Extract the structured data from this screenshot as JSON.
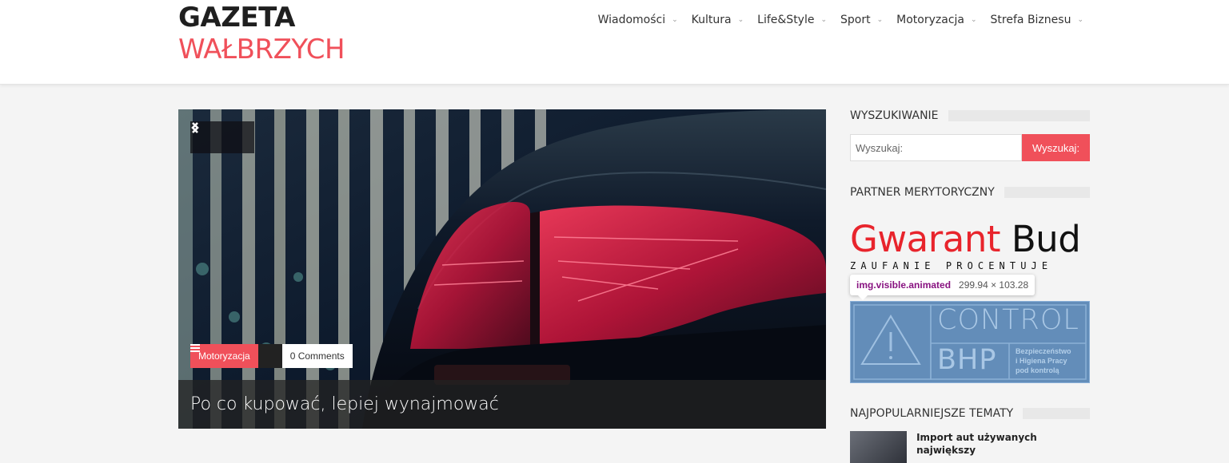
{
  "site": {
    "logo_line1": "GAZETA",
    "logo_line2": "WAŁBRZYCH",
    "accent_color": "#f0505a"
  },
  "nav": {
    "items": [
      {
        "label": "Wiadomości"
      },
      {
        "label": "Kultura"
      },
      {
        "label": "Life&Style"
      },
      {
        "label": "Sport"
      },
      {
        "label": "Motoryzacja"
      },
      {
        "label": "Strefa Biznesu"
      }
    ],
    "chevron_glyph": "⌄"
  },
  "slider": {
    "category": "Motoryzacja",
    "comments": "0 Comments",
    "title": "Po co kupować, lepiej wynajmować",
    "prev_icon": "chevron-left-icon",
    "next_icon": "chevron-right-icon"
  },
  "sidebar": {
    "search": {
      "title": "WYSZUKIWANIE",
      "placeholder": "Wyszukaj:",
      "button_label": "Wyszukaj:"
    },
    "partner": {
      "title": "PARTNER MERYTORYCZNY",
      "gwarant_red": "Gwarant",
      "gwarant_black": "Bud",
      "gwarant_tagline": "ZAUFANIE PROCENTUJE",
      "control_line1": "CONTROL",
      "control_line2": "BHP",
      "control_desc1": "Bezpieczeństwo",
      "control_desc2": "i Higiena Pracy",
      "control_desc3": "pod kontrolą"
    },
    "devtools_tooltip": {
      "selector": "img.visible.animated",
      "dimensions": "299.94 × 103.28"
    },
    "popular": {
      "title": "NAJPOPULARNIEJSZE TEMATY",
      "items": [
        {
          "title": "Import aut używanych największy"
        }
      ]
    }
  }
}
